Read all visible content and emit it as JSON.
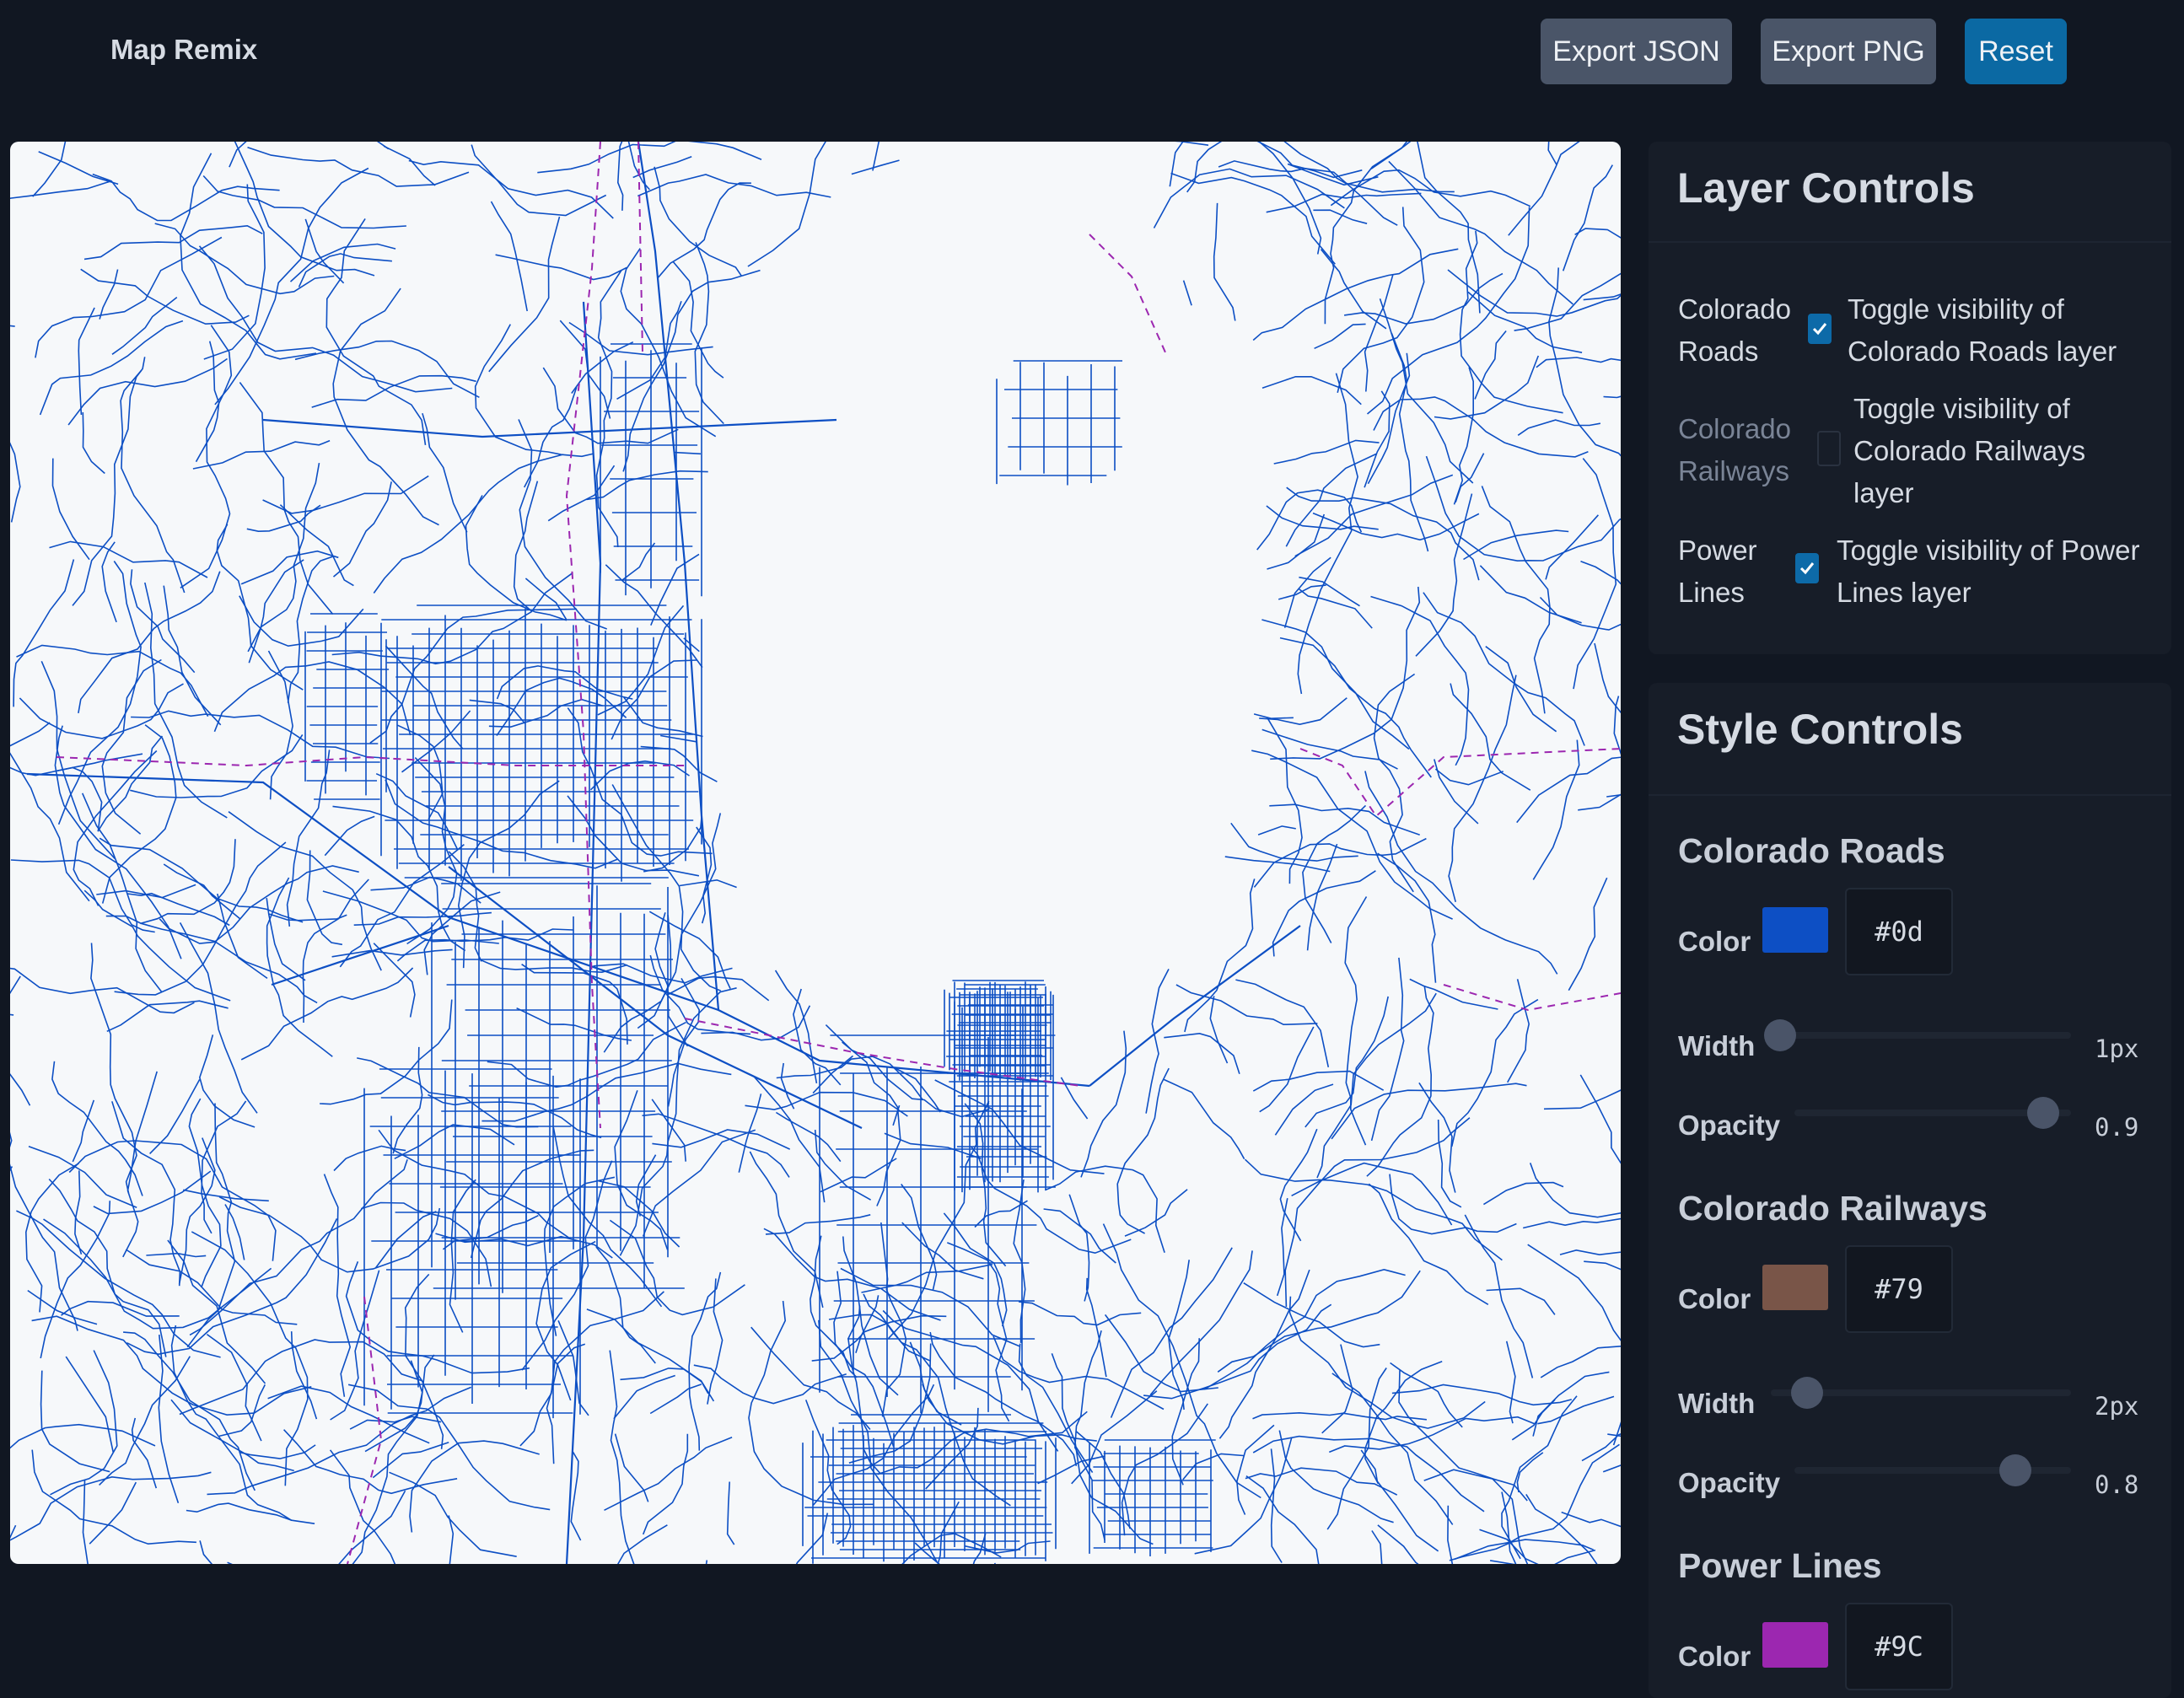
{
  "app": {
    "title": "Map Remix"
  },
  "toolbar": {
    "export_json_label": "Export JSON",
    "export_png_label": "Export PNG",
    "reset_label": "Reset"
  },
  "layer_controls": {
    "title": "Layer Controls",
    "layers": [
      {
        "name_line1": "Colorado",
        "name_line2": "Roads",
        "checked": true,
        "desc_line1": "Toggle visibility of",
        "desc_line2": "Colorado Roads layer",
        "desc_line3": ""
      },
      {
        "name_line1": "Colorado",
        "name_line2": "Railways",
        "checked": false,
        "desc_line1": "Toggle visibility of",
        "desc_line2": "Colorado Railways",
        "desc_line3": "layer"
      },
      {
        "name_line1": "Power",
        "name_line2": "Lines",
        "checked": true,
        "desc_line1": "Toggle visibility of Power",
        "desc_line2": "Lines layer",
        "desc_line3": ""
      }
    ]
  },
  "style_controls": {
    "title": "Style Controls",
    "labels": {
      "color": "Color",
      "width": "Width",
      "opacity": "Opacity"
    },
    "layers": [
      {
        "name": "Colorado Roads",
        "color": "#0d4fc4",
        "hex_display": "#0d",
        "width_value": "1px",
        "width_level": 0.03,
        "opacity_value": "0.9",
        "opacity_level": 0.9
      },
      {
        "name": "Colorado Railways",
        "color": "#795548",
        "hex_display": "#79",
        "width_value": "2px",
        "width_level": 0.12,
        "opacity_value": "0.8",
        "opacity_level": 0.8
      },
      {
        "name": "Power Lines",
        "color": "#9c27b0",
        "hex_display": "#9C"
      }
    ]
  },
  "map": {
    "background": "#f6f8fa",
    "road_color": "#0d4fc4",
    "power_color": "#9c27b0"
  }
}
